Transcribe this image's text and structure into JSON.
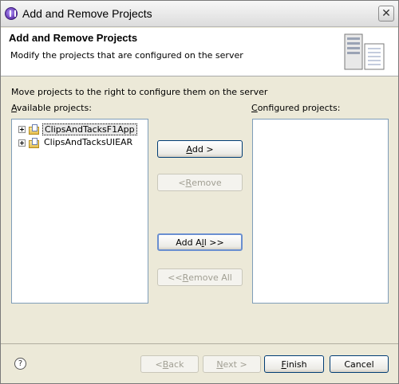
{
  "window": {
    "title": "Add and Remove Projects",
    "close_glyph": "✕"
  },
  "header": {
    "title": "Add and Remove Projects",
    "subtitle": "Modify the projects that are configured on the server"
  },
  "content": {
    "instruction": "Move projects to the right to configure them on the server",
    "available_label": {
      "mnemonic": "A",
      "rest": "vailable projects:"
    },
    "configured_label": {
      "mnemonic": "C",
      "rest": "onfigured projects:"
    },
    "available_projects": [
      {
        "label": "ClipsAndTacksF1App",
        "selected": true
      },
      {
        "label": "ClipsAndTacksUIEAR",
        "selected": false
      }
    ],
    "configured_projects": []
  },
  "buttons": {
    "add": {
      "mnemonic": "A",
      "rest": "dd >"
    },
    "remove": {
      "prefix": "< ",
      "mnemonic": "R",
      "rest": "emove"
    },
    "add_all": {
      "prefix": "Add A",
      "mnemonic": "l",
      "rest": "l >>"
    },
    "remove_all": {
      "prefix": "<< ",
      "mnemonic": "R",
      "rest": "emove All"
    }
  },
  "footer": {
    "help_glyph": "?",
    "back": {
      "prefix": "< ",
      "mnemonic": "B",
      "rest": "ack"
    },
    "next": {
      "prefix": "",
      "mnemonic": "N",
      "rest": "ext >"
    },
    "finish": {
      "prefix": "",
      "mnemonic": "F",
      "rest": "inish"
    },
    "cancel": "Cancel"
  }
}
